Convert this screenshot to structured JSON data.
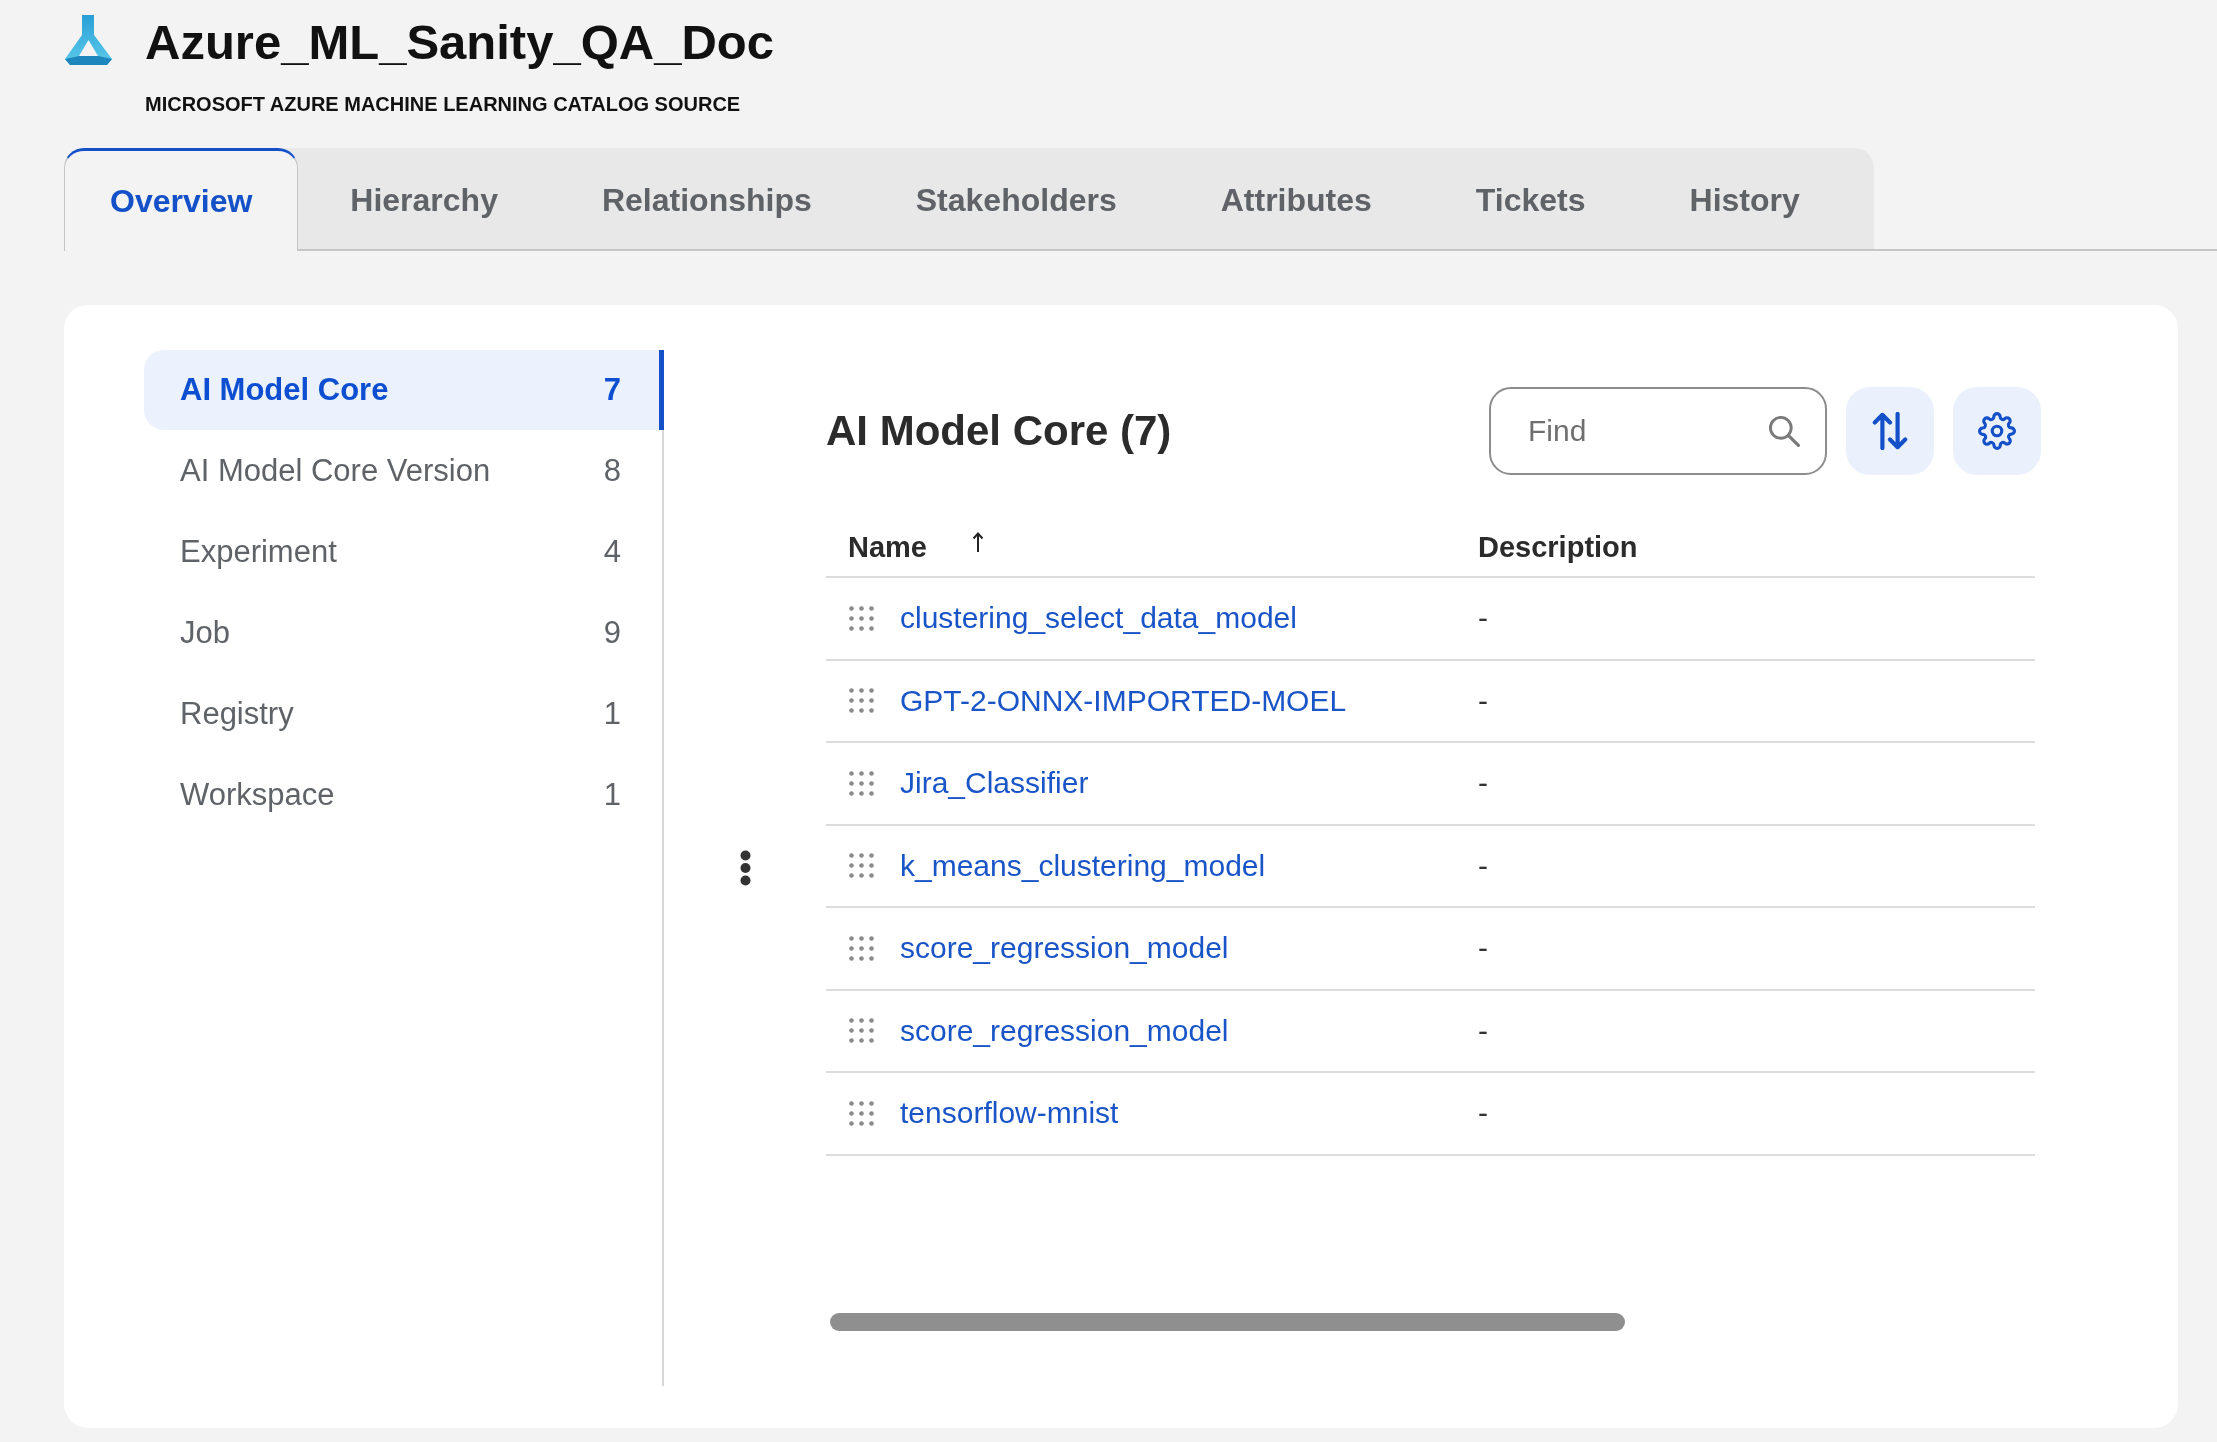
{
  "header": {
    "title": "Azure_ML_Sanity_QA_Doc",
    "subtitle": "MICROSOFT AZURE MACHINE LEARNING CATALOG SOURCE"
  },
  "tabs": [
    {
      "label": "Overview",
      "selected": true
    },
    {
      "label": "Hierarchy",
      "selected": false
    },
    {
      "label": "Relationships",
      "selected": false
    },
    {
      "label": "Stakeholders",
      "selected": false
    },
    {
      "label": "Attributes",
      "selected": false
    },
    {
      "label": "Tickets",
      "selected": false
    },
    {
      "label": "History",
      "selected": false
    }
  ],
  "sidebar": {
    "items": [
      {
        "label": "AI Model Core",
        "count": "7",
        "selected": true
      },
      {
        "label": "AI Model Core Version",
        "count": "8",
        "selected": false
      },
      {
        "label": "Experiment",
        "count": "4",
        "selected": false
      },
      {
        "label": "Job",
        "count": "9",
        "selected": false
      },
      {
        "label": "Registry",
        "count": "1",
        "selected": false
      },
      {
        "label": "Workspace",
        "count": "1",
        "selected": false
      }
    ]
  },
  "panel": {
    "title": "AI Model Core (7)",
    "search": {
      "placeholder": "Find"
    },
    "table": {
      "columns": [
        {
          "label": "Name",
          "sorted": true
        },
        {
          "label": "Description",
          "sorted": false
        }
      ],
      "rows": [
        {
          "name": "clustering_select_data_model",
          "description": "-"
        },
        {
          "name": "GPT-2-ONNX-IMPORTED-MOEL",
          "description": "-"
        },
        {
          "name": "Jira_Classifier",
          "description": "-"
        },
        {
          "name": "k_means_clustering_model",
          "description": "-"
        },
        {
          "name": "score_regression_model",
          "description": "-"
        },
        {
          "name": "score_regression_model",
          "description": "-"
        },
        {
          "name": "tensorflow-mnist",
          "description": "-"
        }
      ]
    }
  }
}
